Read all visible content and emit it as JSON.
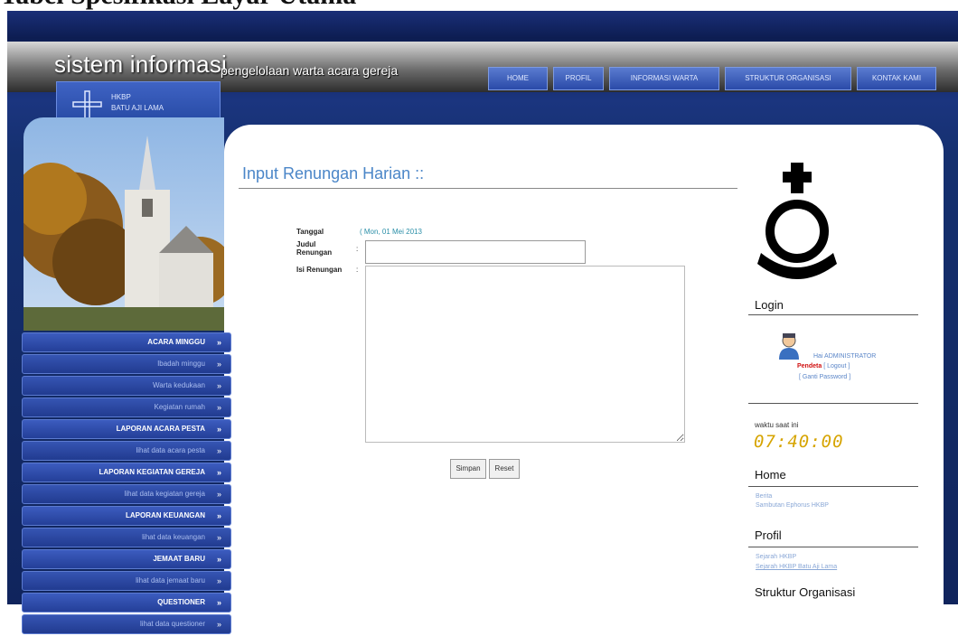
{
  "document": {
    "heading": "Tabel Spesifikasi Layar Utama"
  },
  "header": {
    "brand_main": "sistem informasi",
    "brand_sub": "pengelolaan warta acara gereja",
    "nav": [
      "HOME",
      "PROFIL",
      "INFORMASI WARTA",
      "STRUKTUR ORGANISASI",
      "KONTAK KAMI"
    ],
    "church": {
      "line1": "HKBP",
      "line2": "BATU AJI LAMA"
    }
  },
  "sidebar": {
    "items": [
      {
        "label": "ACARA MINGGU",
        "sub": false
      },
      {
        "label": "Ibadah minggu",
        "sub": true
      },
      {
        "label": "Warta kedukaan",
        "sub": true
      },
      {
        "label": "Kegiatan rumah",
        "sub": true
      },
      {
        "label": "LAPORAN ACARA PESTA",
        "sub": false
      },
      {
        "label": "lihat data acara pesta",
        "sub": true
      },
      {
        "label": "LAPORAN KEGIATAN GEREJA",
        "sub": false
      },
      {
        "label": "lihat data kegiatan gereja",
        "sub": true
      },
      {
        "label": "LAPORAN KEUANGAN",
        "sub": false
      },
      {
        "label": "lihat data keuangan",
        "sub": true
      },
      {
        "label": "JEMAAT BARU",
        "sub": false
      },
      {
        "label": "lihat data jemaat baru",
        "sub": true
      },
      {
        "label": "QUESTIONER",
        "sub": false
      },
      {
        "label": "lihat data questioner",
        "sub": true
      }
    ],
    "arrow": "»"
  },
  "form": {
    "title": "Input Renungan Harian ::",
    "tanggal_label": "Tanggal",
    "tanggal_value": "( Mon, 01 Mei 2013",
    "judul_label_1": "Judul",
    "judul_label_2": "Renungan",
    "isi_label": "Isi Renungan",
    "colon": ":",
    "judul_value": "",
    "isi_value": "",
    "save_button": "Simpan",
    "reset_button": "Reset"
  },
  "right": {
    "login_heading": "Login",
    "login_line1": "Hai ADMINISTRATOR",
    "login_role": "Pendeta",
    "login_logout": "[ Logout ]",
    "login_password": "[ Ganti Password ]",
    "time_label": "waktu saat ini",
    "time_value": "07:40:00",
    "home_heading": "Home",
    "home_links": [
      "Berita",
      "Sambutan Ephorus HKBP"
    ],
    "profil_heading": "Profil",
    "profil_links": [
      "Sejarah HKBP",
      "Sejarah HKBP Batu Aji Lama"
    ],
    "struktur_heading": "Struktur Organisasi"
  },
  "colors": {
    "accent": "#4b86c8",
    "menu": "#2c4aa6",
    "time": "#d6a400"
  }
}
